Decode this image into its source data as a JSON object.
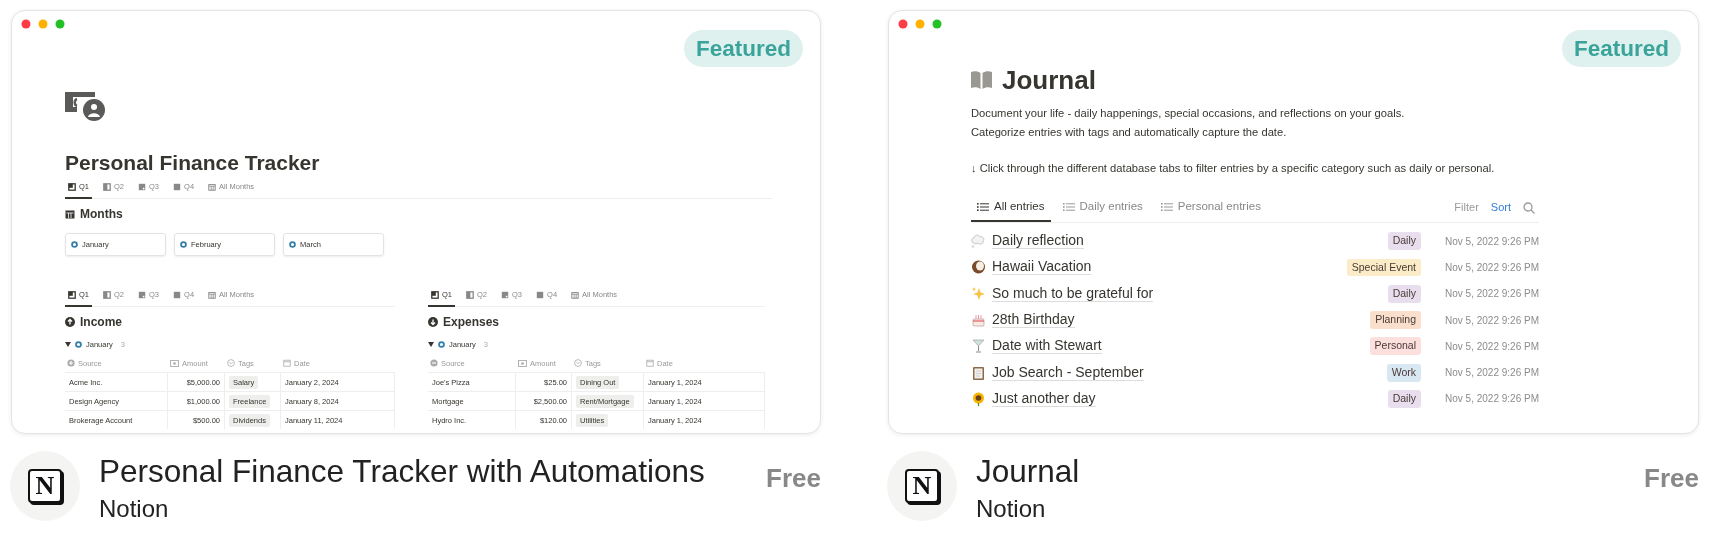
{
  "templates": [
    {
      "kind": "finance",
      "badge": "Featured",
      "preview": {
        "title": "Personal Finance Tracker",
        "tabs": [
          {
            "label": "Q1",
            "selected": true
          },
          {
            "label": "Q2",
            "selected": false
          },
          {
            "label": "Q3",
            "selected": false
          },
          {
            "label": "Q4",
            "selected": false
          },
          {
            "label": "All Months",
            "selected": false
          }
        ],
        "months_heading": "Months",
        "months": [
          "January",
          "February",
          "March"
        ],
        "panels": [
          {
            "tabs": [
              {
                "label": "Q1",
                "selected": true
              },
              {
                "label": "Q2",
                "selected": false
              },
              {
                "label": "Q3",
                "selected": false
              },
              {
                "label": "Q4",
                "selected": false
              },
              {
                "label": "All Months",
                "selected": false
              }
            ],
            "heading": "Income",
            "group": {
              "label": "January",
              "count": "3"
            },
            "columns": [
              "Source",
              "Amount",
              "Tags",
              "Date"
            ],
            "rows": [
              [
                "Acme Inc.",
                "$5,000.00",
                "Salary",
                "January 2, 2024"
              ],
              [
                "Design Agency",
                "$1,000.00",
                "Freelance",
                "January 8, 2024"
              ],
              [
                "Brokerage Account",
                "$500.00",
                "Dividends",
                "January 11, 2024"
              ]
            ]
          },
          {
            "tabs": [
              {
                "label": "Q1",
                "selected": true
              },
              {
                "label": "Q2",
                "selected": false
              },
              {
                "label": "Q3",
                "selected": false
              },
              {
                "label": "Q4",
                "selected": false
              },
              {
                "label": "All Months",
                "selected": false
              }
            ],
            "heading": "Expenses",
            "group": {
              "label": "January",
              "count": "3"
            },
            "columns": [
              "Source",
              "Amount",
              "Tags",
              "Date"
            ],
            "rows": [
              [
                "Joe's Pizza",
                "$25.00",
                "Dining Out",
                "January 1, 2024"
              ],
              [
                "Mortgage",
                "$2,500.00",
                "Rent/Mortgage",
                "January 1, 2024"
              ],
              [
                "Hydro Inc.",
                "$120.00",
                "Utilities",
                "January 1, 2024"
              ]
            ]
          }
        ]
      },
      "listing": {
        "logo": "N",
        "title": "Personal Finance Tracker with Automations",
        "author": "Notion",
        "price": "Free"
      }
    },
    {
      "kind": "journal",
      "badge": "Featured",
      "preview": {
        "title": "Journal",
        "description": [
          "Document your life - daily happenings, special occasions, and reflections on your goals.",
          "Categorize entries with tags and automatically capture the date."
        ],
        "note": "↓ Click through the different database tabs to filter entries by a specific category such as daily or personal.",
        "tabs": [
          {
            "label": "All entries",
            "selected": true
          },
          {
            "label": "Daily entries",
            "selected": false
          },
          {
            "label": "Personal entries",
            "selected": false
          }
        ],
        "filter": "Filter",
        "sort": "Sort",
        "entries": [
          {
            "title": "Daily reflection",
            "tag": "Daily",
            "color": "#e8deee",
            "date": "Nov 5, 2022 9:26 PM"
          },
          {
            "title": "Hawaii Vacation",
            "tag": "Special Event",
            "color": "#fbecc8",
            "date": "Nov 5, 2022 9:26 PM"
          },
          {
            "title": "So much to be grateful for",
            "tag": "Daily",
            "color": "#e8deee",
            "date": "Nov 5, 2022 9:26 PM"
          },
          {
            "title": "28th Birthday",
            "tag": "Planning",
            "color": "#f9dfcc",
            "date": "Nov 5, 2022 9:26 PM"
          },
          {
            "title": "Date with Stewart",
            "tag": "Personal",
            "color": "#fbe0de",
            "date": "Nov 5, 2022 9:26 PM"
          },
          {
            "title": "Job Search - September",
            "tag": "Work",
            "color": "#d8e8f2",
            "date": "Nov 5, 2022 9:26 PM"
          },
          {
            "title": "Just another day",
            "tag": "Daily",
            "color": "#e8deee",
            "date": "Nov 5, 2022 9:26 PM"
          }
        ]
      },
      "listing": {
        "logo": "N",
        "title": "Journal",
        "author": "Notion",
        "price": "Free"
      }
    }
  ]
}
